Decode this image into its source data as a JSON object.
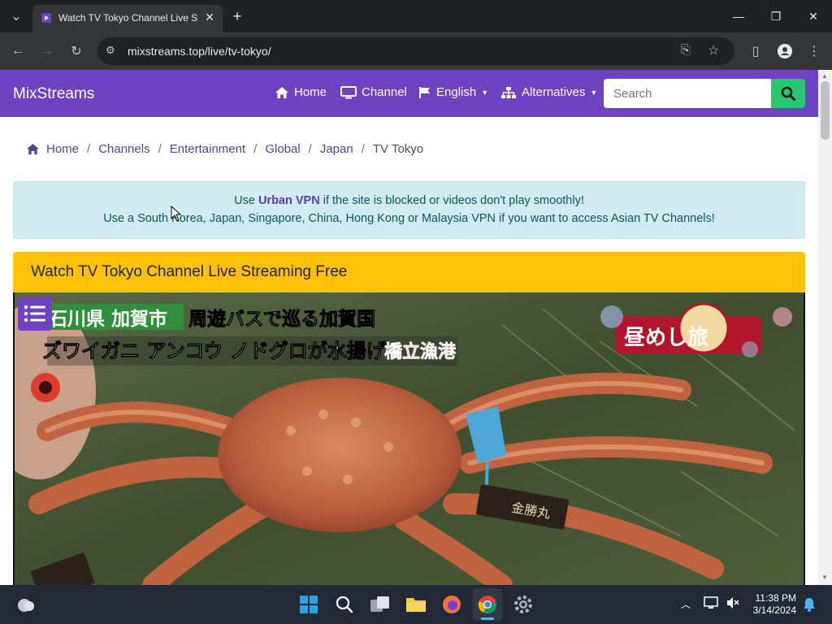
{
  "browser": {
    "tab_title": "Watch TV Tokyo Channel Live Streaming Free",
    "url": "mixstreams.top/live/tv-tokyo/"
  },
  "site": {
    "brand": "MixStreams",
    "nav": {
      "home": "Home",
      "channel": "Channel",
      "language": "English",
      "alternatives": "Alternatives"
    },
    "search_placeholder": "Search"
  },
  "breadcrumb": [
    "Home",
    "Channels",
    "Entertainment",
    "Global",
    "Japan",
    "TV Tokyo"
  ],
  "alert": {
    "line1_pre": "Use ",
    "line1_link": "Urban VPN",
    "line1_post": " if the site is blocked or videos don't play smoothly!",
    "line2": "Use a South Korea, Japan, Singapore, China, Hong Kong or Malaysia VPN if you want to access Asian TV Channels!"
  },
  "card": {
    "title": "Watch TV Tokyo Channel Live Streaming Free"
  },
  "video": {
    "caption_location": "石川県 加賀市",
    "caption_top": "周遊バスで巡る加賀国",
    "caption_main": "ズワイガニ アンコウ ノドグロが水揚げ！",
    "caption_port": "橋立漁港",
    "program_logo": "昼めし旅",
    "tag_text": "金勝丸"
  },
  "taskbar": {
    "time": "11:38 PM",
    "date": "3/14/2024"
  },
  "colors": {
    "navbar": "#6f42c1",
    "card_header": "#ffc107",
    "search_button": "#28c76f",
    "alert_bg": "#d1ecf1"
  }
}
